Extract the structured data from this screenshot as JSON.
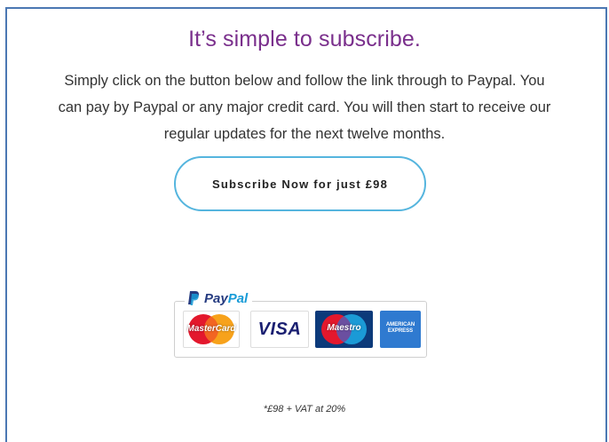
{
  "heading": "It’s simple to subscribe.",
  "body_lines": [
    "Simply click on the button below and follow the link through to Paypal. You",
    "can pay by Paypal or any major credit card. You will then start to receive our",
    "regular updates for the next twelve months."
  ],
  "subscribe_button": "Subscribe Now for just £98",
  "paypal": {
    "brand_pay": "Pay",
    "brand_pal": "Pal",
    "cards": {
      "mastercard": "MasterCard",
      "visa": "VISA",
      "maestro": "Maestro",
      "amex": "AMERICAN EXPRESS"
    }
  },
  "footnote": "*£98 + VAT at 20%",
  "colors": {
    "heading": "#7a2f8c",
    "button_border": "#55b5de",
    "panel_border": "#4b78b3",
    "paypal_dark": "#253b80",
    "paypal_light": "#179bd7"
  }
}
